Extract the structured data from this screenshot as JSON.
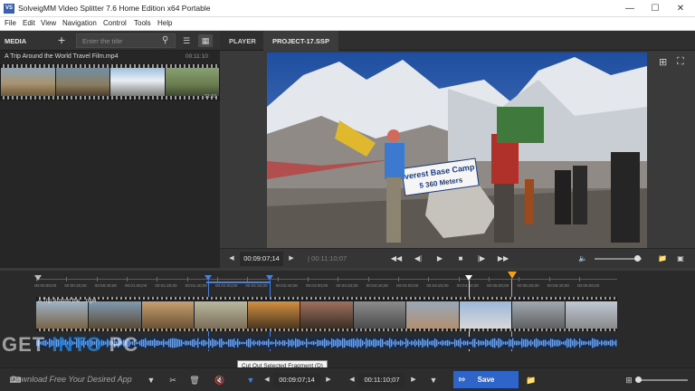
{
  "window": {
    "title": "SolveigMM Video Splitter 7.6 Home Edition x64 Portable",
    "app_icon_text": "VS"
  },
  "menu": [
    "File",
    "Edit",
    "View",
    "Navigation",
    "Control",
    "Tools",
    "Help"
  ],
  "media": {
    "label": "MEDIA",
    "search_placeholder": "Enter the title",
    "clip": {
      "name": "A Trip Around the World Travel Film.mp4",
      "duration": "00:11:10",
      "end_time": "11:10"
    }
  },
  "tabs": [
    {
      "label": "PLAYER",
      "active": false
    },
    {
      "label": "PROJECT-17.SSP",
      "active": true
    }
  ],
  "video_scene": {
    "banner_line1": "verest Base Camp",
    "banner_line2": "5 360 Meters"
  },
  "player_controls": {
    "current_time": "00:09:07;14",
    "total_time": "00:11:10;07"
  },
  "timeline": {
    "ruler_labels": [
      "00:00:00;00",
      "00:00:20;00",
      "00:00:40;00",
      "00:01:00;00",
      "00:01:20;00",
      "00:01:40;00",
      "00:02:00;00",
      "00:02:20;00",
      "00:02:40;00",
      "00:03:00;00",
      "00:03:20;00",
      "00:03:40;00",
      "00:04:00;00",
      "00:04:20;00",
      "00:04:40;00",
      "00:05:00;00",
      "00:05:20;00",
      "00:05:40;00",
      "00:06:00;00"
    ],
    "track_label": "A Trip Around the ...mp4"
  },
  "bottom": {
    "start_time": "00:09:07;14",
    "end_time": "00:11:10;07",
    "save_label": "Save",
    "tooltip": "Cut Out Selected Fragment (D)"
  },
  "watermark": {
    "text_a": "GET ",
    "text_b": "INTO",
    "text_c": " PC",
    "subtitle": "Download Free Your Desired App"
  },
  "colors": {
    "accent_blue": "#2f64c8",
    "marker_orange": "#f0a020",
    "marker_blue": "#4a7fd8",
    "audio_wave": "#6fa0e6"
  }
}
